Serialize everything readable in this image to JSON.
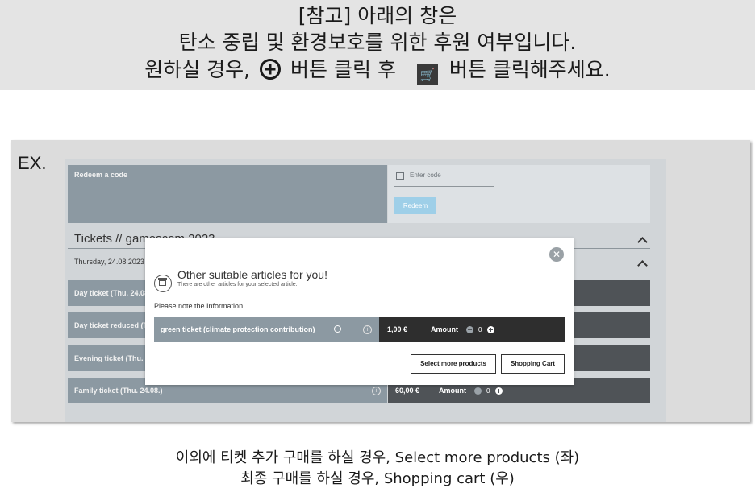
{
  "banner": {
    "line1": "[참고] 아래의 창은",
    "line2": "탄소 중립 및 환경보호를 위한 후원 여부입니다.",
    "line3_a": "원하실 경우,",
    "line3_b": "버튼 클릭 후",
    "line3_c": "버튼 클릭해주세요.",
    "cart_glyph": "🛒"
  },
  "example": {
    "label": "EX.",
    "redeem": {
      "title": "Redeem a code",
      "placeholder": "Enter code",
      "button": "Redeem"
    },
    "section_title": "Tickets // gamescom 2023",
    "date_title": "Thursday, 24.08.2023",
    "tickets": [
      {
        "label": "Day ticket (Thu. 24.08.)"
      },
      {
        "label": "Day ticket reduced (Thu. 24.08.)"
      },
      {
        "label": "Evening ticket (Thu. 24.08.)"
      },
      {
        "label": "Family ticket (Thu. 24.08.)",
        "price": "60,00 €",
        "amount_label": "Amount",
        "qty": "0"
      }
    ],
    "modal": {
      "close_glyph": "✕",
      "title": "Other suitable articles for you!",
      "subtitle": "There are other articles for your selected article.",
      "note": "Please note the Information.",
      "item_label": "green ticket (climate protection contribution)",
      "item_price": "1,00 €",
      "amount_label": "Amount",
      "qty": "0",
      "btn_more": "Select more products",
      "btn_cart": "Shopping Cart"
    }
  },
  "footer": {
    "line1": "이외에 티켓 추가 구매를 하실 경우,  Select more products (좌)",
    "line2": "최종 구매를 하실 경우,  Shopping cart  (우)"
  }
}
